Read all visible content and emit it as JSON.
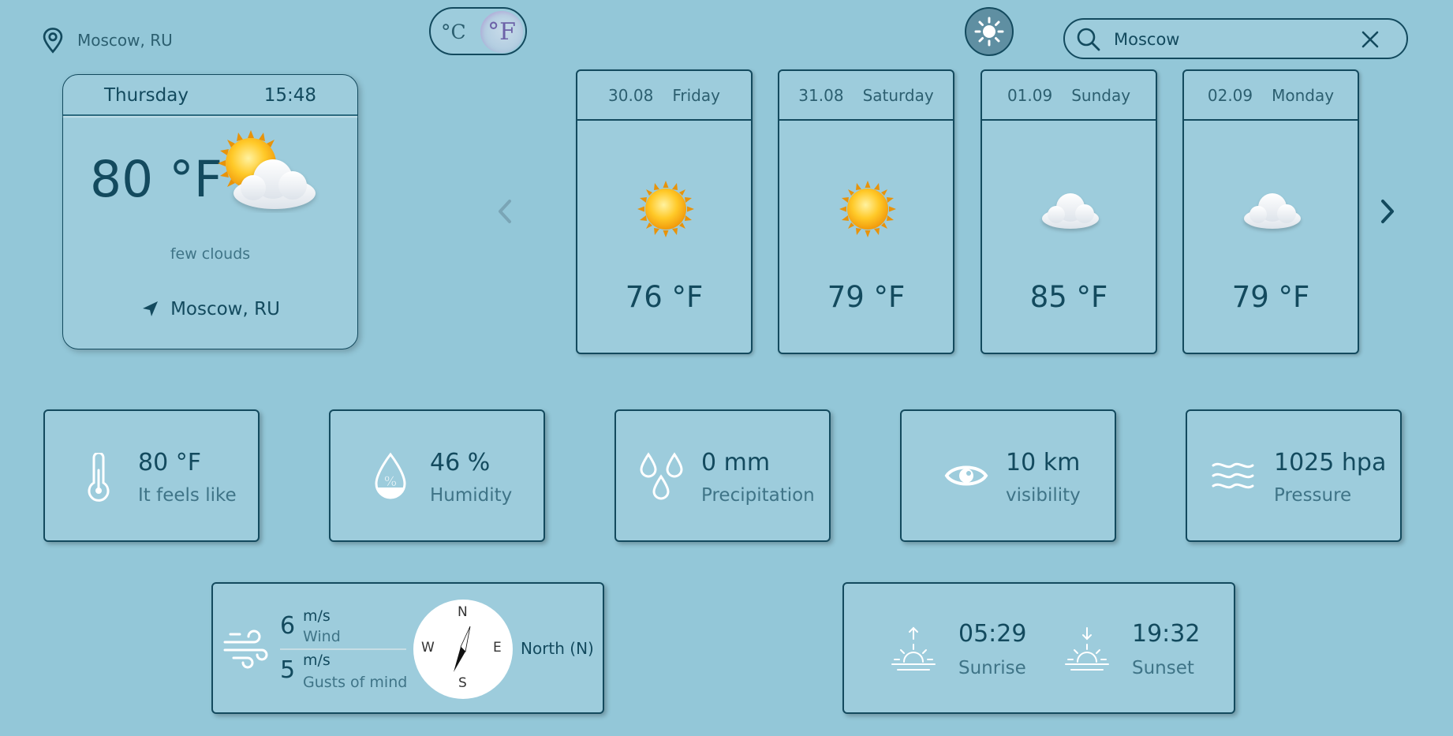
{
  "header": {
    "location": "Moscow, RU",
    "unit_celsius": "°C",
    "unit_fahrenheit": "°F",
    "active_unit": "fahrenheit",
    "search_value": "Moscow",
    "icons": [
      "location-pin-icon",
      "sun-icon",
      "search-icon",
      "close-icon"
    ]
  },
  "current": {
    "day": "Thursday",
    "time": "15:48",
    "temp": "80 °F",
    "description": "few clouds",
    "location": "Moscow, RU",
    "icon": "sun-behind-cloud-icon"
  },
  "forecast": [
    {
      "date": "30.08",
      "day": "Friday",
      "temp": "76 °F",
      "icon": "sun-icon"
    },
    {
      "date": "31.08",
      "day": "Saturday",
      "temp": "79 °F",
      "icon": "sun-icon"
    },
    {
      "date": "01.09",
      "day": "Sunday",
      "temp": "85 °F",
      "icon": "cloud-icon"
    },
    {
      "date": "02.09",
      "day": "Monday",
      "temp": "79 °F",
      "icon": "cloud-icon"
    }
  ],
  "stats": {
    "feels": {
      "value": "80 °F",
      "label": "It feels like",
      "icon": "thermometer-icon"
    },
    "humidity": {
      "value": "46 %",
      "label": "Humidity",
      "icon": "humidity-drop-icon"
    },
    "precip": {
      "value": "0 mm",
      "label": "Precipitation",
      "icon": "raindrops-icon"
    },
    "visibility": {
      "value": "10 km",
      "label": "visibility",
      "icon": "eye-icon"
    },
    "pressure": {
      "value": "1025 hpa",
      "label": "Pressure",
      "icon": "waves-icon"
    }
  },
  "wind": {
    "speed": "6",
    "speed_unit": "m/s",
    "speed_label": "Wind",
    "gust": "5",
    "gust_unit": "m/s",
    "gust_label": "Gusts of mind",
    "compass_n": "N",
    "compass_s": "S",
    "compass_e": "E",
    "compass_w": "W",
    "direction": "North (N)"
  },
  "sun": {
    "sunrise": "05:29",
    "sunrise_label": "Sunrise",
    "sunset": "19:32",
    "sunset_label": "Sunset"
  },
  "colors": {
    "background": "#93c7d8",
    "card": "#9dccdc",
    "border": "#134a5e",
    "text": "#134a5e",
    "muted": "#3f7487"
  }
}
